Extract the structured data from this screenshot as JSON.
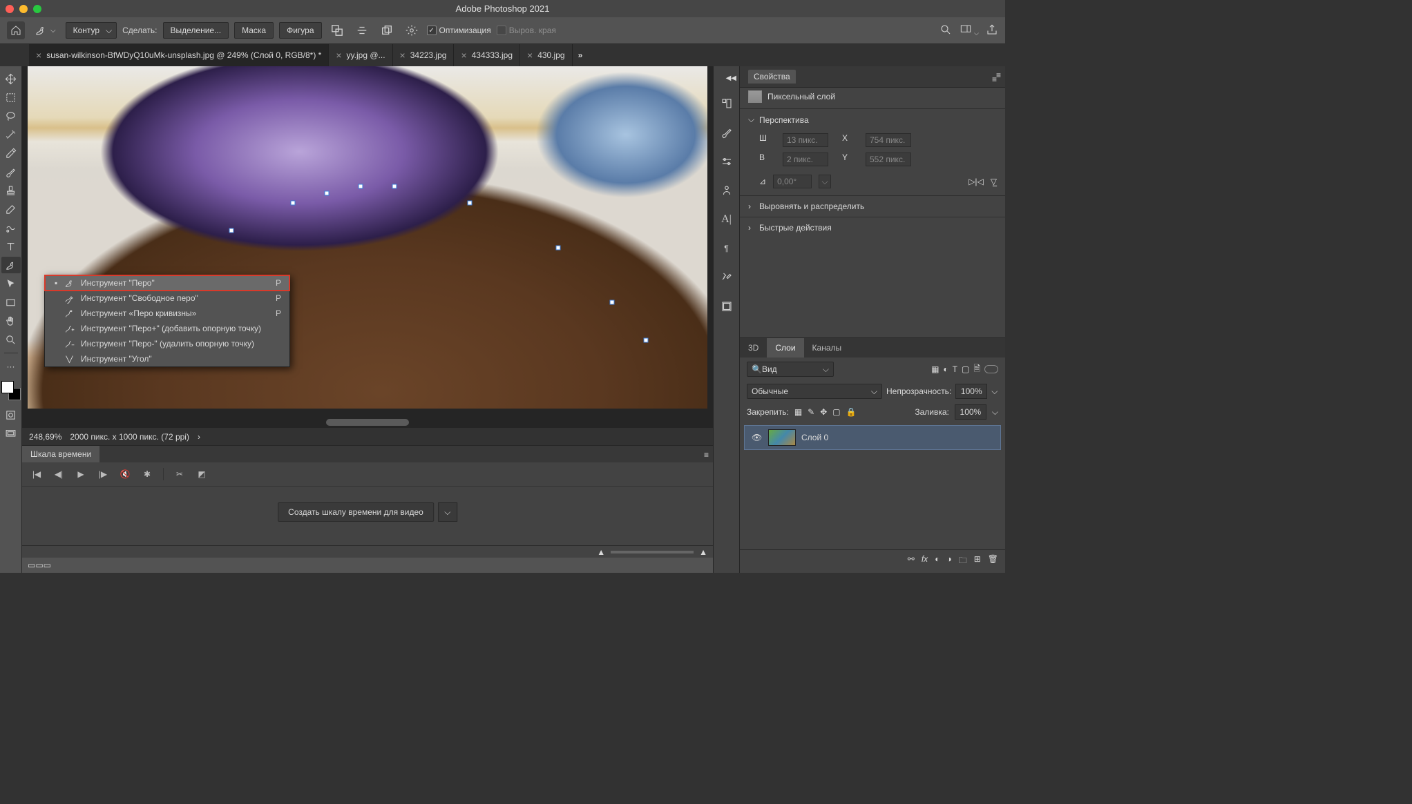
{
  "app": {
    "title": "Adobe Photoshop 2021"
  },
  "options": {
    "mode": "Контур",
    "make_label": "Сделать:",
    "selection": "Выделение...",
    "mask": "Маска",
    "shape": "Фигура",
    "optimize": "Оптимизация",
    "align_edges": "Выров. края"
  },
  "tabs": [
    {
      "name": "susan-wilkinson-BfWDyQ10uMk-unsplash.jpg @ 249% (Слой 0, RGB/8*) *",
      "active": true
    },
    {
      "name": "yy.jpg @...",
      "active": false
    },
    {
      "name": "34223.jpg",
      "active": false
    },
    {
      "name": "434333.jpg",
      "active": false
    },
    {
      "name": "430.jpg",
      "active": false
    }
  ],
  "flyout": {
    "items": [
      {
        "label": "Инструмент \"Перо\"",
        "shortcut": "P",
        "current": true
      },
      {
        "label": "Инструмент \"Свободное перо\"",
        "shortcut": "P",
        "current": false
      },
      {
        "label": "Инструмент «Перо кривизны»",
        "shortcut": "P",
        "current": false
      },
      {
        "label": "Инструмент \"Перо+\" (добавить опорную точку)",
        "shortcut": "",
        "current": false
      },
      {
        "label": "Инструмент \"Перо-\" (удалить опорную точку)",
        "shortcut": "",
        "current": false
      },
      {
        "label": "Инструмент \"Угол\"",
        "shortcut": "",
        "current": false
      }
    ]
  },
  "status": {
    "zoom": "248,69%",
    "docinfo": "2000 пикс. x 1000 пикс. (72 ppi)"
  },
  "properties": {
    "panel_title": "Свойства",
    "layer_type": "Пиксельный слой",
    "transform_section": "Перспектива",
    "w_label": "Ш",
    "w_val": "13 пикс.",
    "h_label": "В",
    "h_val": "2 пикс.",
    "x_label": "X",
    "x_val": "754 пикс.",
    "y_label": "Y",
    "y_val": "552 пикс.",
    "angle": "0,00°",
    "align_section": "Выровнять и распределить",
    "quick_section": "Быстрые действия"
  },
  "layers_panel": {
    "tabs": {
      "3d": "3D",
      "layers": "Слои",
      "channels": "Каналы"
    },
    "filter": "Вид",
    "blend": "Обычные",
    "opacity_label": "Непрозрачность:",
    "opacity": "100%",
    "lock_label": "Закрепить:",
    "fill_label": "Заливка:",
    "fill": "100%",
    "layer0": "Слой 0"
  },
  "timeline": {
    "title": "Шкала времени",
    "create": "Создать шкалу времени для видео"
  }
}
